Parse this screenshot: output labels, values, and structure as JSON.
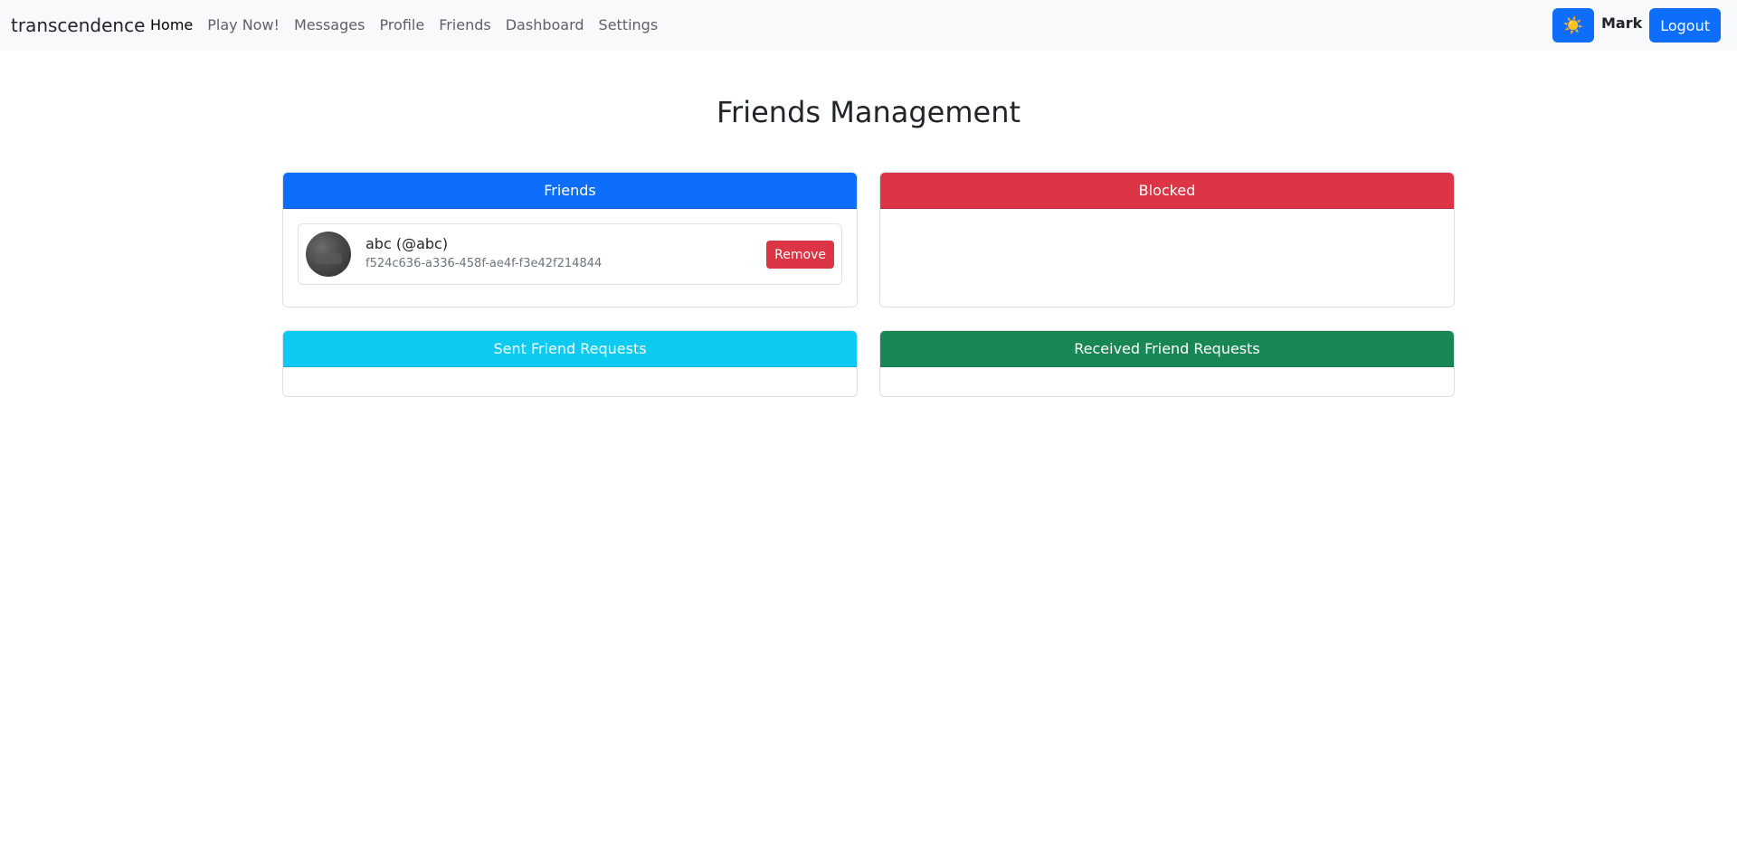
{
  "navbar": {
    "brand": "transcendence",
    "links": [
      "Home",
      "Play Now!",
      "Messages",
      "Profile",
      "Friends",
      "Dashboard",
      "Settings"
    ],
    "active_link": "Home",
    "theme_icon": "sun-icon",
    "theme_glyph": "☀️",
    "user_name": "Mark",
    "logout_label": "Logout"
  },
  "page": {
    "title": "Friends Management"
  },
  "cards": {
    "friends": {
      "header": "Friends",
      "items": [
        {
          "name": "abc (@abc)",
          "id": "f524c636-a336-458f-ae4f-f3e42f214844",
          "action": "Remove"
        }
      ]
    },
    "blocked": {
      "header": "Blocked"
    },
    "sent": {
      "header": "Sent Friend Requests"
    },
    "received": {
      "header": "Received Friend Requests"
    }
  },
  "colors": {
    "primary": "#0d6efd",
    "danger": "#dc3545",
    "info": "#0dcaf0",
    "success": "#198754",
    "navbar_bg": "#f8f9fa"
  }
}
